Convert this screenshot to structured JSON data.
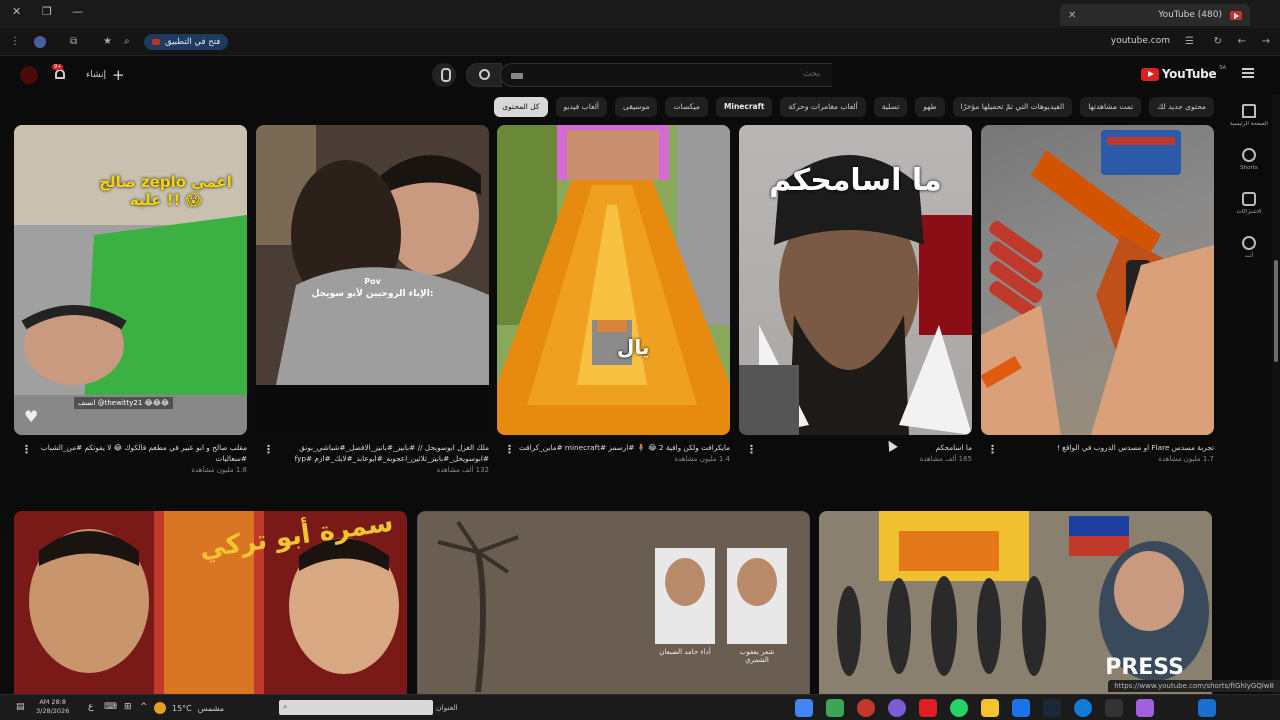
{
  "browser": {
    "tab_title": "(480) YouTube",
    "url": "youtube.com",
    "open_in_app": "فتح في التطبيق",
    "status_url": "https://www.youtube.com/shorts/fIGhlyGQlw8"
  },
  "header": {
    "logo_text": "YouTube",
    "logo_region": "SA",
    "search_placeholder": "بحث",
    "create_label": "إنشاء",
    "notifications_count": "9+"
  },
  "chips": [
    {
      "label": "كل المحتوى",
      "selected": true
    },
    {
      "label": "ألعاب فيديو"
    },
    {
      "label": "موسيقى"
    },
    {
      "label": "ميكسات"
    },
    {
      "label": "Minecraft",
      "bold": true
    },
    {
      "label": "ألعاب مغامرات وحركة"
    },
    {
      "label": "تسلية"
    },
    {
      "label": "طهو"
    },
    {
      "label": "الفيديوهات التي تمّ تحميلها مؤخرًا"
    },
    {
      "label": "تمت مشاهدتها"
    },
    {
      "label": "محتوى جديد لك"
    }
  ],
  "sidebar": [
    {
      "label": "الصفحة الرئيسية",
      "icon": "home-icon"
    },
    {
      "label": "Shorts",
      "icon": "shorts-icon"
    },
    {
      "label": "الاشتراكات",
      "icon": "subscriptions-icon"
    },
    {
      "label": "أنت",
      "icon": "you-icon"
    }
  ],
  "shorts": [
    {
      "title": "تجربة مسدس Flare او مسدس الدروب في الواقع !",
      "views": "1.7 مليون مشاهدة"
    },
    {
      "title": "ما اسامحكم",
      "views": "165 ألف مشاهدة",
      "overlay": "ما اسامحكم"
    },
    {
      "title": "مايكرافت ولكن وافية 2 😂 🧍 #ارسمز #minecraft #ماين_كرافت",
      "views": "1.4 مليون مشاهدة",
      "overlay": "يال"
    },
    {
      "title": "ملك الغزل ابوسويحل // #بانيز_#بانيز_الافضل_#شباشي_بونق #ابوسويحل_#بانيز_ثلاثين_اعجوبه_#ابوعابد_#لايك_#ازم #fyp",
      "views": "132 ألف مشاهدة",
      "overlay_line1": "Pov",
      "overlay_line2": "الإباء الروحيين لأبو سويحل:"
    },
    {
      "title": "مقلب صالح و ابو عبير في مطعم فالكوك 😂 لا يفوتكم #من_الشباب #سعاليات",
      "views": "1.8 مليون مشاهدة",
      "overlay": "صالح zeplo اغمي عليه !! 😱",
      "credit": "انسف @thewitty21 😂😂😂"
    }
  ],
  "videos": [
    {
      "overlay": "PRESS"
    },
    {
      "name_left": "أداء حامد الضبعان",
      "name_right": "شعر يعقوب الشمري"
    },
    {
      "overlay": "سمرة أبو تركي"
    }
  ],
  "taskbar": {
    "time": "AM 28:8",
    "date": "3/28/2026",
    "weather_temp": "15°C",
    "weather_label": "مشمس",
    "search_label": "العنوان"
  }
}
